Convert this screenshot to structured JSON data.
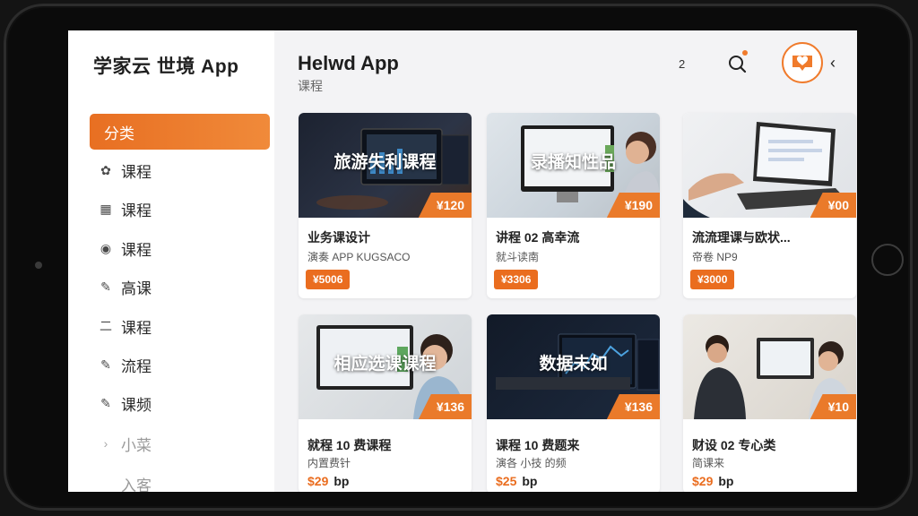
{
  "sidebar": {
    "brand": "学家云 世境 App",
    "items": [
      {
        "label": "分类",
        "icon": "none",
        "active": true
      },
      {
        "label": "课程",
        "icon": "flower-icon"
      },
      {
        "label": "课程",
        "icon": "grid-icon"
      },
      {
        "label": "课程",
        "icon": "circle-play-icon"
      },
      {
        "label": "高课",
        "icon": "pencil-icon"
      },
      {
        "label": "课程",
        "icon": "equals-icon"
      },
      {
        "label": "流程",
        "icon": "pencil-icon"
      },
      {
        "label": "课频",
        "icon": "pencil-icon"
      },
      {
        "label": "小菜",
        "icon": "chevron-right-icon"
      },
      {
        "label": "入客",
        "icon": "none"
      }
    ]
  },
  "header": {
    "title": "Helwd App",
    "subtitle": "课程",
    "counter": "2"
  },
  "accent_color": "#ea6d1f",
  "cards": [
    {
      "thumb_title": "旅游失利课程",
      "price_tag": "¥120",
      "title": "业务课设计",
      "subtitle": "演奏 APP KUGSACO",
      "badge": "¥5006",
      "theme": "dark-monitor"
    },
    {
      "thumb_title": "录播知性品",
      "price_tag": "¥190",
      "title": "讲程 02 高幸流",
      "subtitle": "就斗读南",
      "badge": "¥3306",
      "theme": "woman-monitor"
    },
    {
      "thumb_title": "",
      "price_tag": "¥00",
      "title": "流流理课与欧状...",
      "subtitle": "帝卷 NP9",
      "badge": "¥3000",
      "theme": "laptop-hands"
    },
    {
      "thumb_title": "相应选课课程",
      "price_tag": "¥136",
      "title": "就程 10 费课程",
      "subtitle": "内置费针",
      "price_value": "$29",
      "price_unit": "bp",
      "theme": "woman-desk"
    },
    {
      "thumb_title": "数据未如",
      "price_tag": "¥136",
      "title": "课程 10 费题来",
      "subtitle": "演各 小技 的频",
      "price_value": "$25",
      "price_unit": "bp",
      "theme": "dashboard"
    },
    {
      "thumb_title": "",
      "price_tag": "¥10",
      "title": "财设 02 专心类",
      "subtitle": "简课来",
      "price_value": "$29",
      "price_unit": "bp",
      "theme": "two-people"
    }
  ]
}
